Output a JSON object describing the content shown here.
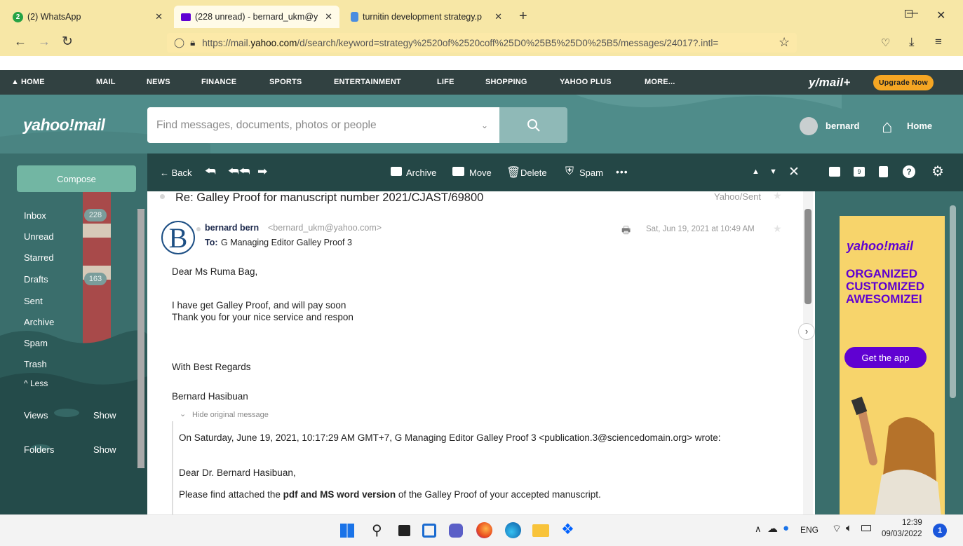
{
  "browser": {
    "tabs": [
      {
        "label": "(2) WhatsApp",
        "badge": "2"
      },
      {
        "label": "(228 unread) - bernard_ukm@y"
      },
      {
        "label": "turnitin development strategy.p"
      }
    ],
    "url_prefix": "https://mail.",
    "url_domain": "yahoo.com",
    "url_path": "/d/search/keyword=strategy%2520of%2520coff%25D0%25B5%25D0%25B5/messages/24017?.intl=",
    "new_tab": "+"
  },
  "yahoo_nav": {
    "items": [
      "HOME",
      "MAIL",
      "NEWS",
      "FINANCE",
      "SPORTS",
      "ENTERTAINMENT",
      "LIFE",
      "SHOPPING",
      "YAHOO PLUS",
      "MORE..."
    ],
    "brand": "y/mail+",
    "upgrade": "Upgrade Now"
  },
  "header": {
    "logo": "yahoo!mail",
    "search_placeholder": "Find messages, documents, photos or people",
    "user": "bernard",
    "home": "Home"
  },
  "sidebar": {
    "compose": "Compose",
    "folders": [
      {
        "label": "Inbox",
        "count": "228"
      },
      {
        "label": "Unread"
      },
      {
        "label": "Starred"
      },
      {
        "label": "Drafts",
        "count": "163"
      },
      {
        "label": "Sent"
      },
      {
        "label": "Archive"
      },
      {
        "label": "Spam"
      },
      {
        "label": "Trash"
      }
    ],
    "less": "^ Less",
    "views": "Views",
    "views_show": "Show",
    "folders_label": "Folders",
    "folders_show": "Show"
  },
  "toolbar": {
    "back": "← Back",
    "archive": "Archive",
    "move": "Move",
    "delete": "Delete",
    "spam": "Spam",
    "more": "•••"
  },
  "message": {
    "subject": "Re: Galley Proof for manuscript number 2021/CJAST/69800",
    "folder_tag": "Yahoo/Sent",
    "sender_name": "bernard bern",
    "sender_email": "<bernard_ukm@yahoo.com>",
    "to_label": "To:",
    "to": "G Managing Editor Galley Proof 3",
    "date": "Sat, Jun 19, 2021 at 10:49 AM",
    "greeting": "Dear Ms Ruma Bag,",
    "line1": "I have get Galley Proof, and will pay soon",
    "line2": "Thank you for your nice service and respon",
    "regards": "With Best Regards",
    "signature": "Bernard Hasibuan",
    "hide_original": "Hide original message",
    "quoted_header": "On Saturday, June 19, 2021, 10:17:29 AM GMT+7, G Managing Editor Galley Proof 3 <publication.3@sciencedomain.org> wrote:",
    "quoted_greeting": "Dear Dr. Bernard Hasibuan,",
    "quoted_line_a": "Please find attached the ",
    "quoted_line_bold": "pdf and MS word version",
    "quoted_line_b": " of the Galley Proof of your accepted manuscript."
  },
  "ad": {
    "logo": "yahoo!mail",
    "line1": "ORGANIZED",
    "line2": "CUSTOMIZED",
    "line3": "AWESOMIZEI",
    "cta": "Get the app"
  },
  "taskbar": {
    "lang": "ENG",
    "time": "12:39",
    "date": "09/03/2022",
    "notif": "1"
  },
  "colors": {
    "tabbar": "#f7e7a6",
    "yahoo_nav": "#314141",
    "header": "#4f8c8a",
    "sidebar": "#3a6e6c",
    "toolbar": "#244746",
    "upgrade": "#f5a623",
    "ad_bg": "#f7d46b",
    "ad_text": "#5f01d1"
  }
}
